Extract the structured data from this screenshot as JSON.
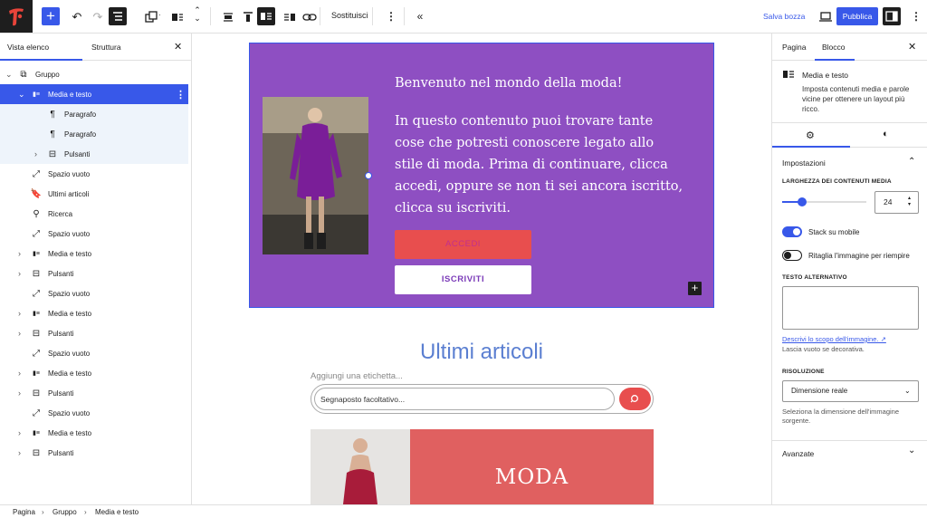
{
  "topbar": {
    "replace_label": "Sostituisci",
    "save_draft_label": "Salva bozza",
    "publish_label": "Pubblica"
  },
  "left_panel": {
    "tab_list": "Vista elenco",
    "tab_structure": "Struttura",
    "items": [
      {
        "label": "Gruppo",
        "icon": "group-icon"
      },
      {
        "label": "Media e testo",
        "icon": "media-text-icon"
      },
      {
        "label": "Paragrafo",
        "icon": "paragraph-icon"
      },
      {
        "label": "Paragrafo",
        "icon": "paragraph-icon"
      },
      {
        "label": "Pulsanti",
        "icon": "buttons-icon"
      },
      {
        "label": "Spazio vuoto",
        "icon": "spacer-icon"
      },
      {
        "label": "Ultimi articoli",
        "icon": "bookmark-icon"
      },
      {
        "label": "Ricerca",
        "icon": "search-icon"
      },
      {
        "label": "Spazio vuoto",
        "icon": "spacer-icon"
      },
      {
        "label": "Media e testo",
        "icon": "media-text-icon"
      },
      {
        "label": "Pulsanti",
        "icon": "buttons-icon"
      },
      {
        "label": "Spazio vuoto",
        "icon": "spacer-icon"
      },
      {
        "label": "Media e testo",
        "icon": "media-text-icon"
      },
      {
        "label": "Pulsanti",
        "icon": "buttons-icon"
      },
      {
        "label": "Spazio vuoto",
        "icon": "spacer-icon"
      },
      {
        "label": "Media e testo",
        "icon": "media-text-icon"
      },
      {
        "label": "Pulsanti",
        "icon": "buttons-icon"
      },
      {
        "label": "Spazio vuoto",
        "icon": "spacer-icon"
      },
      {
        "label": "Media e testo",
        "icon": "media-text-icon"
      },
      {
        "label": "Pulsanti",
        "icon": "buttons-icon"
      }
    ]
  },
  "canvas": {
    "heading": "Benvenuto nel mondo della moda!",
    "body": "In questo contenuto puoi trovare tante cose che potresti conoscere legato allo stile di moda. Prima di continuare, clicca accedi, oppure se non ti sei ancora iscritto, clicca su iscriviti.",
    "btn_login": "ACCEDI",
    "btn_signup": "ISCRIVITI",
    "latest_title": "Ultimi articoli",
    "search_label": "Aggiungi una etichetta...",
    "search_placeholder": "Segnaposto facoltativo...",
    "moda_text": "MODA"
  },
  "right_panel": {
    "tab_page": "Pagina",
    "tab_block": "Blocco",
    "block_name": "Media e testo",
    "block_desc": "Imposta contenuti media e parole vicine per ottenere un layout più ricco.",
    "settings_title": "Impostazioni",
    "media_width_label": "LARGHEZZA DEI CONTENUTI MEDIA",
    "media_width_value": "24",
    "media_width_fraction": 0.24,
    "stack_label": "Stack su mobile",
    "stack_on": true,
    "crop_label": "Ritaglia l'immagine per riempire",
    "crop_on": false,
    "alt_label": "TESTO ALTERNATIVO",
    "alt_link": "Descrivi lo scopo dell'immagine.",
    "alt_help": "Lascia vuoto se decorativa.",
    "resolution_label": "RISOLUZIONE",
    "resolution_value": "Dimensione reale",
    "resolution_help": "Seleziona la dimensione dell'immagine sorgente.",
    "advanced_label": "Avanzate"
  },
  "breadcrumb": [
    "Pagina",
    "Gruppo",
    "Media e testo"
  ],
  "colors": {
    "accent": "#3858e9",
    "purple": "#8e4fc2",
    "red": "#e84e4e",
    "moda_bg": "#e06060",
    "latest_title": "#5b7fd1"
  }
}
